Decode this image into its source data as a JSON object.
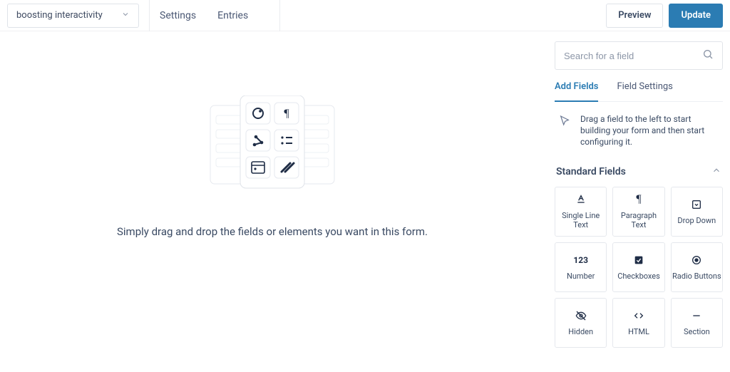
{
  "header": {
    "form_name": "boosting interactivity",
    "links": {
      "settings": "Settings",
      "entries": "Entries"
    },
    "buttons": {
      "preview": "Preview",
      "update": "Update"
    }
  },
  "canvas": {
    "hint": "Simply drag and drop the fields or elements you want in this form."
  },
  "panel": {
    "search_placeholder": "Search for a field",
    "tabs": {
      "add": "Add Fields",
      "settings": "Field Settings"
    },
    "helper": "Drag a field to the left to start building your form and then start configuring it.",
    "section": "Standard Fields",
    "fields": {
      "single_line": "Single Line Text",
      "paragraph": "Paragraph Text",
      "dropdown": "Drop Down",
      "number": "Number",
      "checkboxes": "Checkboxes",
      "radio": "Radio Buttons",
      "hidden": "Hidden",
      "html": "HTML",
      "section": "Section"
    }
  }
}
